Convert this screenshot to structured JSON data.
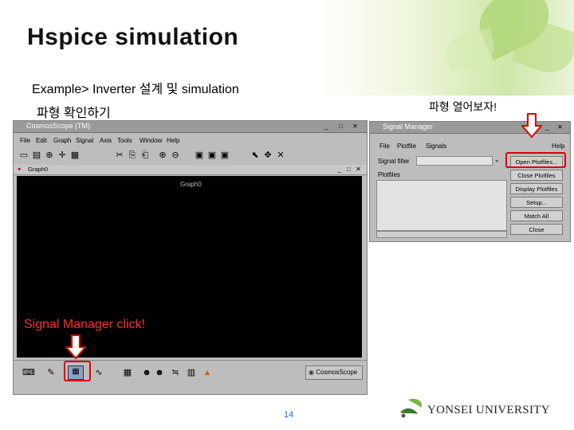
{
  "slide": {
    "title": "Hspice simulation",
    "subtitle": "Example> Inverter 설계 및 simulation",
    "caption_left": "파형 확인하기",
    "caption_right": "파형 열어보자!",
    "page_number": "14",
    "logo_text": "YONSEI UNIVERSITY"
  },
  "cosmos_window": {
    "title": "CosmosScope (TM)",
    "title_buttons": [
      "_",
      "□",
      "✕"
    ],
    "menu": [
      "File",
      "Edit",
      "Graph",
      "Signal",
      "Axis",
      "Tools",
      "Window",
      "Help"
    ],
    "graph_window_title": "Graph0",
    "graph_label": "Graph0",
    "annotation": "Signal Manager click!",
    "brand": "CosmosScope"
  },
  "signal_manager": {
    "title": "Signal Manager",
    "title_buttons": [
      "_",
      "✕"
    ],
    "menu": [
      "File",
      "Plotfile",
      "Signals",
      "Help"
    ],
    "signal_filter_label": "Signal filter",
    "plotfiles_label": "Plotfiles",
    "buttons": [
      "Open Plotfiles...",
      "Close Plotfiles",
      "Display Plotfiles",
      "Setup...",
      "Match All",
      "Close"
    ]
  },
  "colors": {
    "annotation_red": "#ff2a2a",
    "graph_bg": "#000000",
    "page_num_blue": "#2a64c8"
  }
}
